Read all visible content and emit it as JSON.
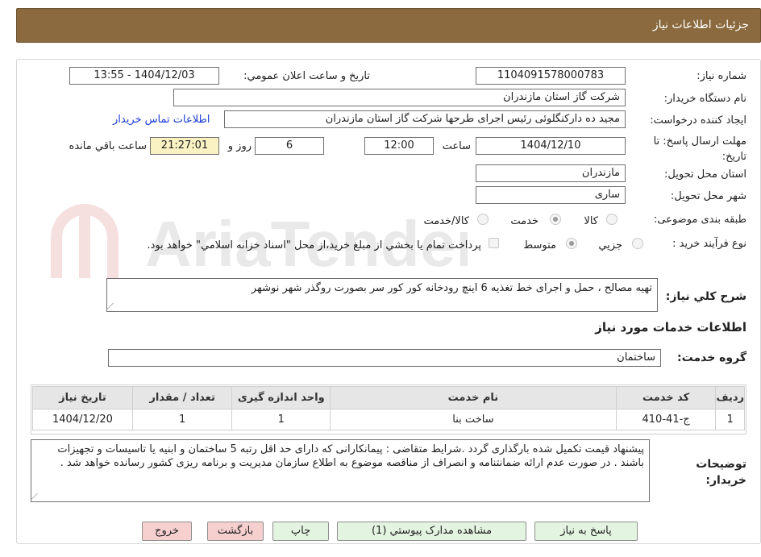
{
  "header": {
    "title": "جزئیات اطلاعات نیاز"
  },
  "fields": {
    "need_number_label": "شماره نیاز:",
    "need_number": "1104091578000783",
    "announce_label": "تاریخ و ساعت اعلان عمومي:",
    "announce_value": "1404/12/03 - 13:55",
    "buyer_org_label": "نام دستگاه خريدار:",
    "buyer_org": "شركت گاز استان مازندران",
    "creator_label": "ايجاد كننده درخواست:",
    "creator": "مجید ده دارکنگلوئی رئیس اجرای طرحها شركت گاز استان مازندران",
    "contact_link": "اطلاعات تماس خريدار",
    "deadline_label": "مهلت ارسال پاسخ: تا تاريخ:",
    "deadline_date": "1404/12/10",
    "hour_label": "ساعت",
    "deadline_time": "12:00",
    "days_value": "6",
    "days_label": "روز و",
    "remaining_time": "21:27:01",
    "remaining_label": "ساعت باقي مانده",
    "province_label": "استان محل تحويل:",
    "province": "مازندران",
    "city_label": "شهر محل تحويل:",
    "city": "ساری",
    "category_label": "طبقه بندی موضوعی:",
    "category_options": [
      "کالا",
      "خدمت",
      "کالا/خدمت"
    ],
    "category_selected": "خدمت",
    "process_label": "نوع فرآيند خريد :",
    "process_options": [
      "جزيي",
      "متوسط"
    ],
    "process_selected": "متوسط",
    "payment_note": "پرداخت تمام يا بخشي از مبلغ خريد،از محل \"اسناد خزانه اسلامي\" خواهد بود.",
    "summary_label": "شرح كلي نياز:",
    "summary": "تهیه مصالح ، حمل و اجرای خط تغذیه 6 اینچ رودخانه کور کور سر بصورت روگذر شهر نوشهر"
  },
  "services": {
    "section_title": "اطلاعات خدمات مورد نياز",
    "group_label": "گروه خدمت:",
    "group_value": "ساختمان",
    "columns": [
      "رديف",
      "كد خدمت",
      "نام خدمت",
      "واحد اندازه گيری",
      "تعداد / مقدار",
      "تاريخ نياز"
    ],
    "rows": [
      [
        "1",
        "ج-41-410",
        "ساخت بنا",
        "1",
        "1",
        "1404/12/20"
      ]
    ]
  },
  "buyer_notes": {
    "label": "توضيحات خريدار:",
    "text": "پیشنهاد قیمت تکمیل شده بارگذاری گردد .شرایط متقاضی : پیمانکارانی که دارای حد اقل رتبه 5 ساختمان و ابنیه یا تاسیسات و تجهیزات باشند . در صورت عدم ارائه ضمانتنامه و انصراف از مناقصه موضوع به اطلاع سازمان مدیریت و برنامه ریزی کشور رسانده خواهد شد ."
  },
  "buttons": {
    "reply": "پاسخ به نياز",
    "attachments": "مشاهده مدارک پيوستي (1)",
    "print": "چاپ",
    "back": "بازگشت",
    "exit": "خروج"
  },
  "watermark": {
    "text": "AriaTender.neT"
  },
  "colors": {
    "header_bg": "#8a6a3e",
    "timer_bg": "#fbf2c4",
    "btn_green": "#e3f4e0",
    "btn_red": "#f6cfcf",
    "link": "#1a3bd6"
  }
}
